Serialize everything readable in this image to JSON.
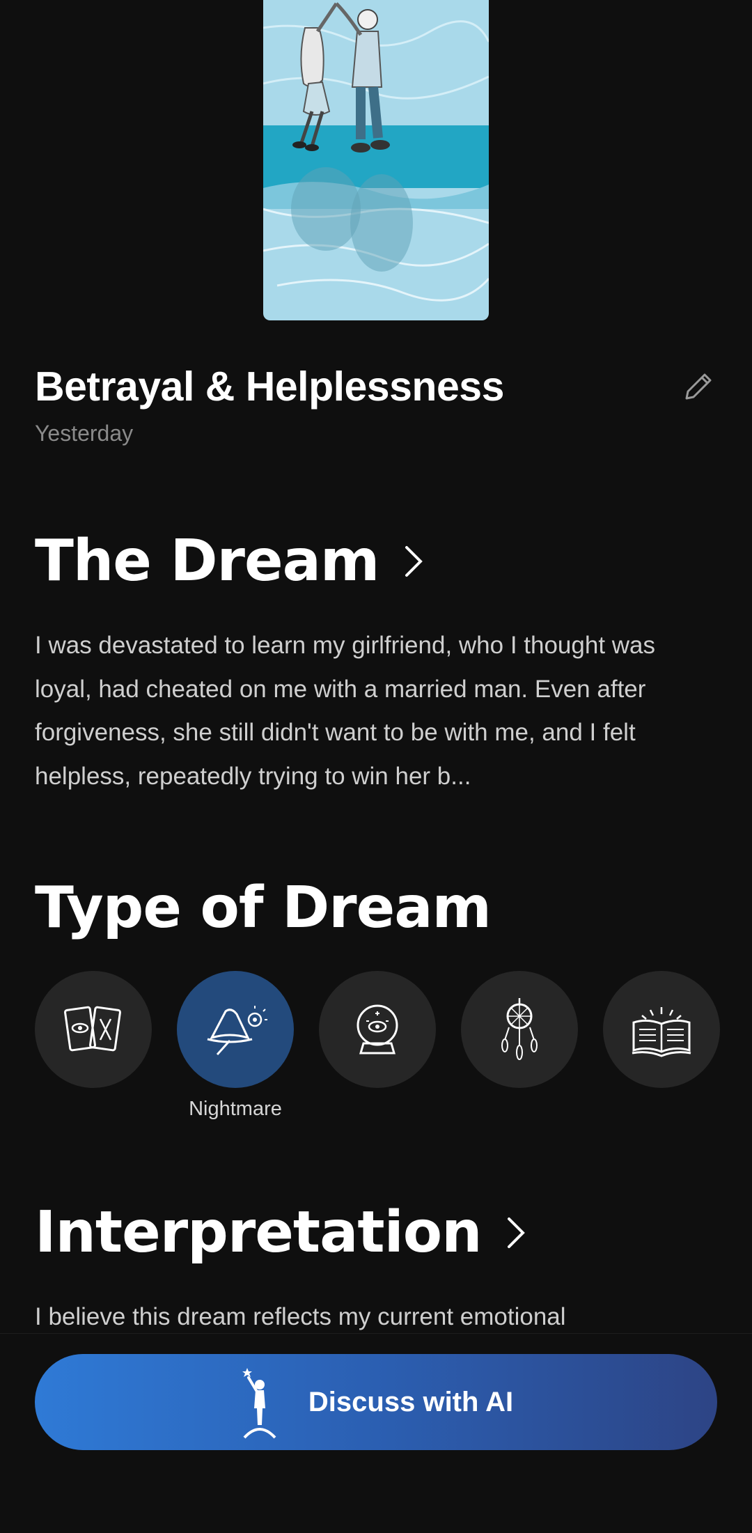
{
  "dream": {
    "title": "Betrayal & Helplessness",
    "date": "Yesterday"
  },
  "sections": {
    "dream_heading": "The Dream",
    "dream_text": "I was devastated to learn my girlfriend, who I thought was loyal, had cheated on me with a married man. Even after forgiveness, she still didn't want to be with me, and I felt helpless, repeatedly trying to win her b...",
    "type_heading": "Type of Dream",
    "interpretation_heading": "Interpretation",
    "interpretation_text": "I believe this dream reflects my current emotional"
  },
  "dream_types": [
    {
      "icon": "tarot-cards-icon",
      "label": "",
      "selected": false
    },
    {
      "icon": "wizard-hat-icon",
      "label": "Nightmare",
      "selected": true
    },
    {
      "icon": "crystal-ball-icon",
      "label": "",
      "selected": false
    },
    {
      "icon": "dreamcatcher-icon",
      "label": "",
      "selected": false
    },
    {
      "icon": "open-book-icon",
      "label": "",
      "selected": false
    }
  ],
  "cta": {
    "label": "Discuss with AI",
    "icon": "figure-reaching-star-icon"
  },
  "colors": {
    "background": "#0f0f0f",
    "selected_type": "#234a7c",
    "cta_start": "#2f7ad6",
    "cta_end": "#2d4485"
  }
}
